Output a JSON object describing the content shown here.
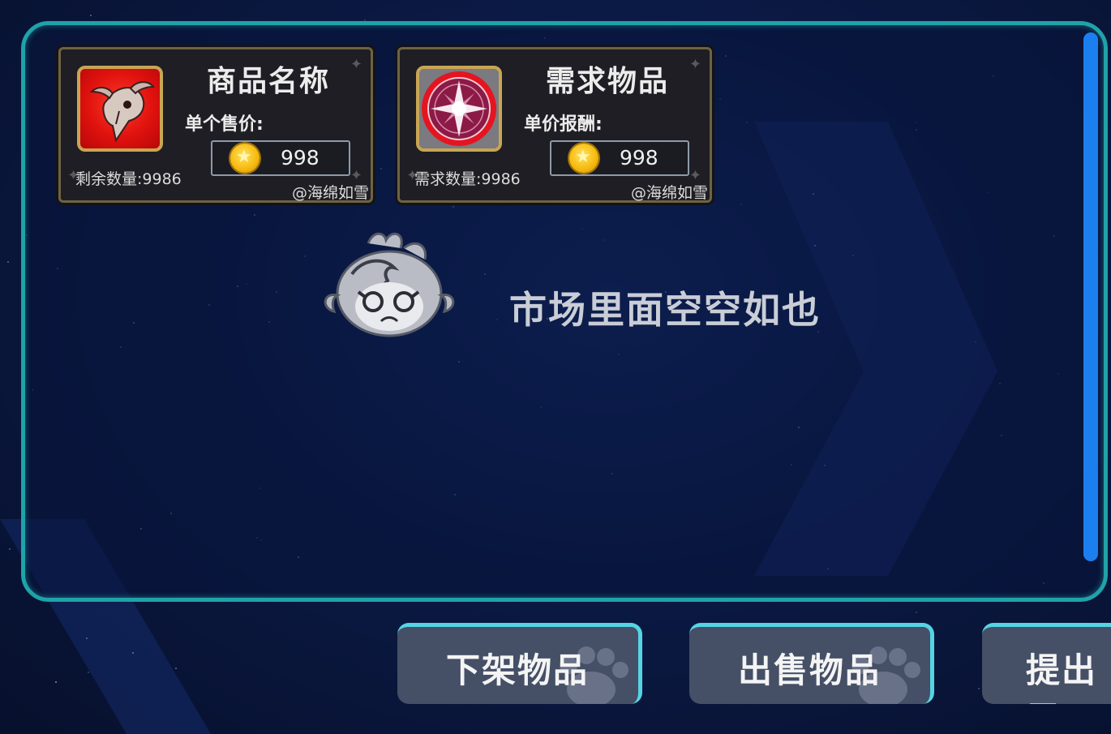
{
  "market": {
    "empty_message": "市场里面空空如也"
  },
  "cards": [
    {
      "title": "商品名称",
      "price_label": "单个售价:",
      "price": "998",
      "quantity": "剩余数量:9986",
      "author": "@海绵如雪",
      "icon": "skull-icon"
    },
    {
      "title": "需求物品",
      "price_label": "单价报酬:",
      "price": "998",
      "quantity": "需求数量:9986",
      "author": "@海绵如雪",
      "icon": "compass-emblem-icon"
    }
  ],
  "buttons": {
    "delist": "下架物品",
    "sell": "出售物品",
    "submit": "提出需"
  },
  "colors": {
    "panel_border": "#1fa3a8",
    "scrollbar": "#1b7ff0",
    "button_bg": "#454f66",
    "button_accent": "#55d4e4",
    "card_border": "#6e6342",
    "coin": "#f6b80d"
  }
}
